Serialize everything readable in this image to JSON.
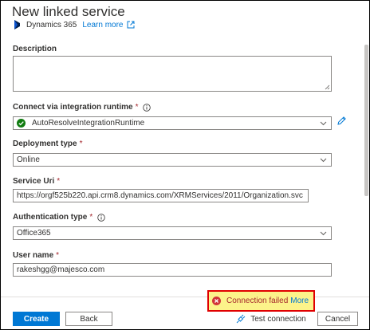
{
  "header": {
    "title": "New linked service",
    "service_name": "Dynamics 365",
    "learn_more": "Learn more"
  },
  "form": {
    "description": {
      "label": "Description",
      "value": ""
    },
    "integration_runtime": {
      "label": "Connect via integration runtime",
      "required": "*",
      "value": "AutoResolveIntegrationRuntime"
    },
    "deployment_type": {
      "label": "Deployment type",
      "required": "*",
      "value": "Online"
    },
    "service_uri": {
      "label": "Service Uri",
      "required": "*",
      "value": "https://orgf525b220.api.crm8.dynamics.com/XRMServices/2011/Organization.svc"
    },
    "authentication_type": {
      "label": "Authentication type",
      "required": "*",
      "value": "Office365"
    },
    "user_name": {
      "label": "User name",
      "required": "*",
      "value": "rakeshgg@majesco.com"
    }
  },
  "status": {
    "message": "Connection failed",
    "more": "More"
  },
  "footer": {
    "create": "Create",
    "back": "Back",
    "test_connection": "Test connection",
    "cancel": "Cancel"
  },
  "colors": {
    "accent": "#0078d4",
    "required": "#a4262c",
    "success": "#107c10",
    "error": "#d13438",
    "highlight": "#fcf38a"
  }
}
